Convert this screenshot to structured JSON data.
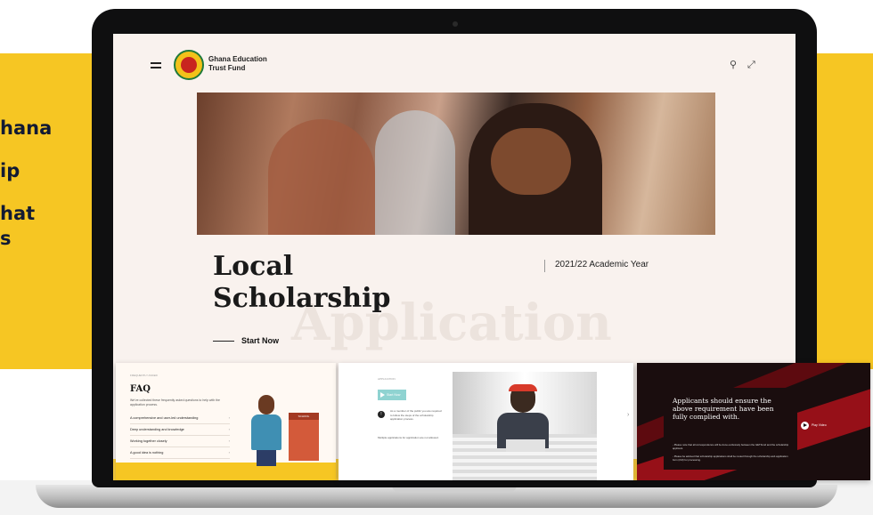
{
  "promo": {
    "lines": [
      "hana",
      "ip",
      "hat",
      "s"
    ]
  },
  "header": {
    "brand_line1": "Ghana Education",
    "brand_line2": "Trust Fund",
    "logo_text": "GETFUND"
  },
  "hero": {
    "title_line1": "Local",
    "title_line2": "Scholarship",
    "ghost_text": "Application",
    "year": "2021/22 Academic Year",
    "cta": "Start Now"
  },
  "card_faq": {
    "eyebrow": "FREQUENTLY ASKED",
    "title": "FAQ",
    "description": "We've collected these frequently asked questions to help with the application process.",
    "items": [
      "A comprehensive and user-led understanding",
      "Deep understanding and knowledge",
      "Working together closely",
      "A good idea is nothing",
      "Attention to quality"
    ],
    "sign": "SCHOOL"
  },
  "card_apply": {
    "eyebrow": "APPLICATION",
    "button": "Start Now",
    "info_text": "As a member of the public you are required to follow the steps of the scholarship application process.",
    "note": "Multiple applications for application are not allowed."
  },
  "card_notice": {
    "title": "Applicants should ensure the above requirement have been fully complied with.",
    "bullet1": "- Please note that all correspondence will be done exclusively between the GETFund and the scholarship applicant.",
    "bullet2": "- Please be advised that scholarship applications shall be routed through the scholarship web application form (CM) for processing.",
    "play_label": "Play Video"
  },
  "icons": [
    "hamburger-icon",
    "search-icon",
    "expand-icon",
    "info-icon",
    "play-icon",
    "chevron-right-icon"
  ],
  "colors": {
    "accent_yellow": "#f6c623",
    "screen_bg": "#f9f2ee",
    "teal_button": "#8fd3d1",
    "notice_bg": "#1a0d0e",
    "ribbon_red": "#b5121b"
  }
}
